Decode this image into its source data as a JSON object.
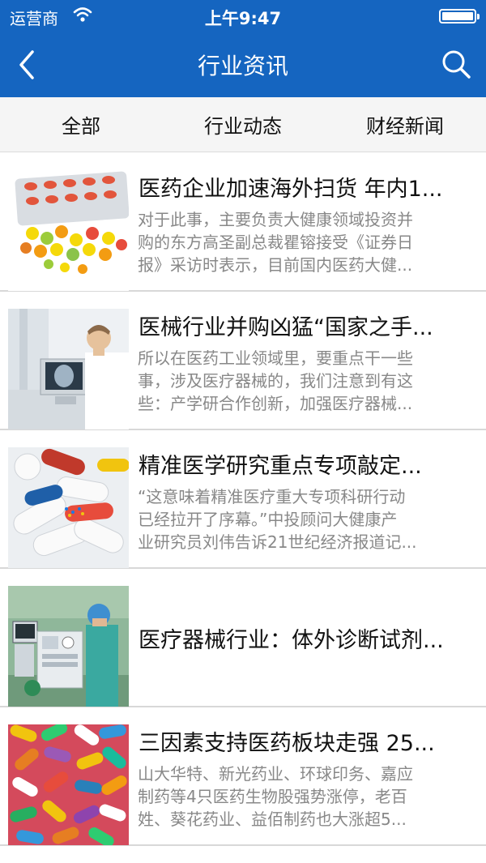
{
  "status": {
    "carrier": "运营商",
    "time": "上午9:47"
  },
  "nav": {
    "title": "行业资讯"
  },
  "tabs": [
    {
      "label": "全部"
    },
    {
      "label": "行业动态"
    },
    {
      "label": "财经新闻"
    }
  ],
  "news": [
    {
      "title": "医药企业加速海外扫货 年内1...",
      "summary": [
        "对于此事，主要负责大健康领域投资并",
        "购的东方高圣副总裁瞿镕接受《证券日",
        "报》采访时表示，目前国内医药大健..."
      ]
    },
    {
      "title": "医械行业并购凶猛“国家之手...",
      "summary": [
        "所以在医药工业领域里，要重点干一些",
        "事，涉及医疗器械的，我们注意到有这",
        "些：产学研合作创新，加强医疗器械..."
      ]
    },
    {
      "title": "精准医学研究重点专项敲定...",
      "summary": [
        "“这意味着精准医疗重大专项科研行动",
        "已经拉开了序幕。”中投顾问大健康产",
        "业研究员刘伟告诉21世纪经济报道记..."
      ]
    },
    {
      "title": "医疗器械行业：体外诊断试剂...",
      "summary": []
    },
    {
      "title": "三因素支持医药板块走强 25...",
      "summary": [
        "山大华特、新光药业、环球印务、嘉应",
        "制药等4只医药生物股强势涨停，老百",
        "姓、葵花药业、益佰制药也大涨超5..."
      ]
    }
  ],
  "colors": {
    "header": "#1565c0",
    "tab_bg": "#f5f5f5",
    "summary_text": "#888888"
  }
}
